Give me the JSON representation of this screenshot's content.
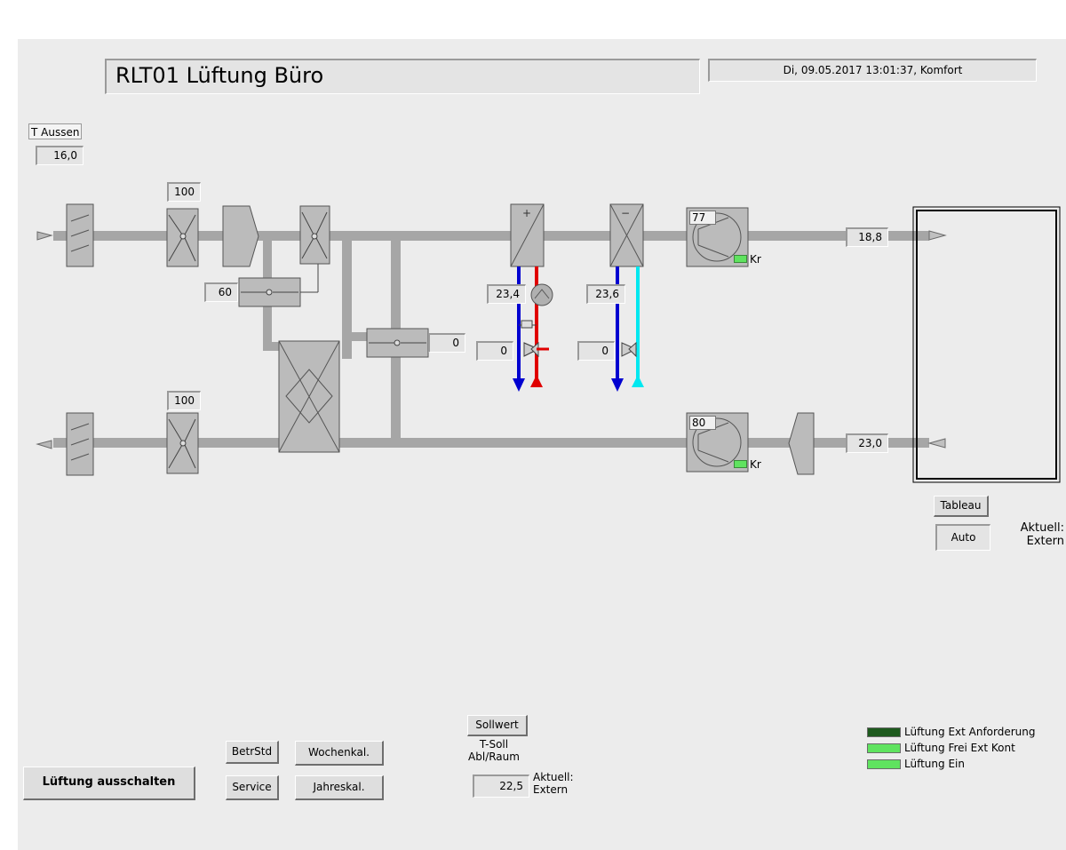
{
  "header": {
    "title": "RLT01 Lüftung Büro",
    "datetime": "Di, 09.05.2017 13:01:37, Komfort"
  },
  "outside_temp": {
    "label": "T Aussen",
    "value": "16,0"
  },
  "dampers": {
    "outdoor_air": "100",
    "exhaust_air": "100",
    "recirculation": "60",
    "bypass": "0"
  },
  "heating": {
    "temp": "23,4",
    "valve": "0"
  },
  "cooling": {
    "temp": "23,6",
    "valve": "0"
  },
  "fans": {
    "supply": {
      "value": "77",
      "label": "Kr"
    },
    "return": {
      "value": "80",
      "label": "Kr"
    }
  },
  "supply_temp": "18,8",
  "return_temp": "23,0",
  "room": {
    "tableau_label": "Tableau",
    "mode_value": "Auto",
    "mode_status": "Aktuell:\nExtern"
  },
  "setpoint": {
    "button_label": "Sollwert",
    "caption": "T-Soll\nAbl/Raum",
    "value": "22,5",
    "status": "Aktuell:\nExtern"
  },
  "buttons": {
    "betrstd": "BetrStd",
    "wochenkal": "Wochenkal.",
    "service": "Service",
    "jahreskal": "Jahreskal.",
    "switch_off": "Lüftung ausschalten"
  },
  "status_leds": [
    {
      "label": "Lüftung Ext Anforderung",
      "state": "off",
      "color": "#1e5a1e"
    },
    {
      "label": "Lüftung Frei Ext Kont",
      "state": "on",
      "color": "#5fe35f"
    },
    {
      "label": "Lüftung Ein",
      "state": "on",
      "color": "#5fe35f"
    }
  ],
  "colors": {
    "duct": "#a6a6a6",
    "heating_supply": "#e00000",
    "heating_return": "#0000d0",
    "cooling_return": "#0000d0",
    "cooling_supply": "#00e8f0"
  }
}
